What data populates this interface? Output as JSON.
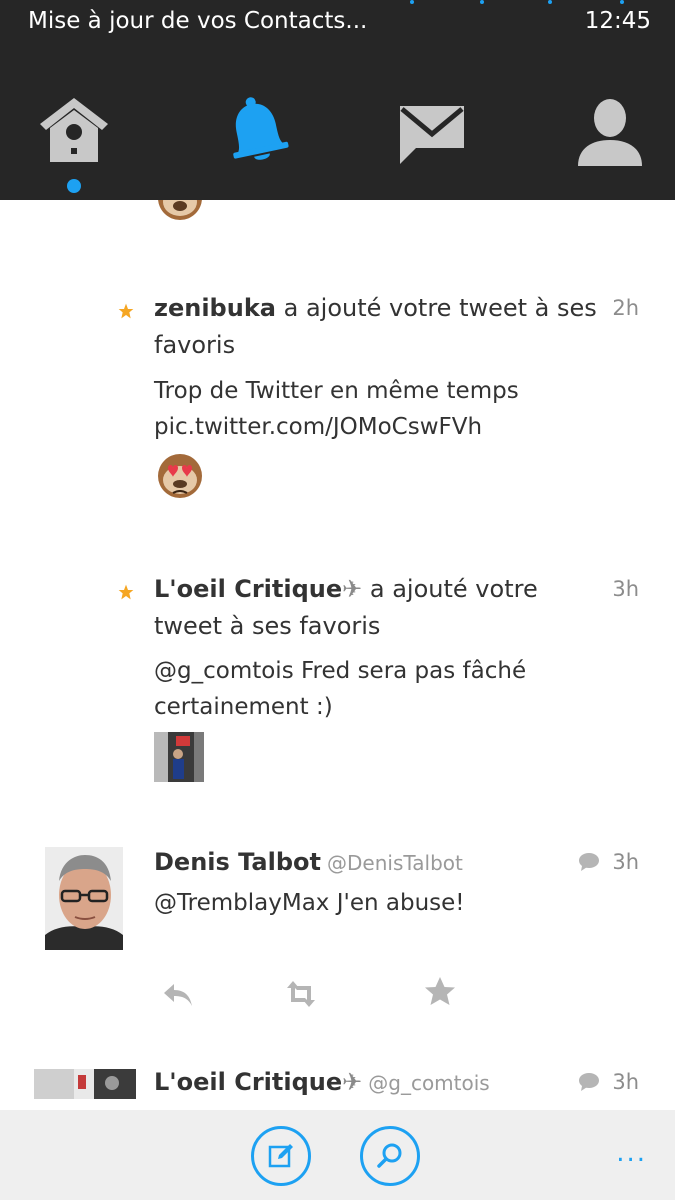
{
  "status_bar": {
    "text": "Mise à jour de vos Contacts...",
    "time": "12:45"
  },
  "nav": {
    "tabs": [
      {
        "icon": "home-birdhouse-icon",
        "active": true
      },
      {
        "icon": "notifications-bell-icon",
        "active": false
      },
      {
        "icon": "messages-envelope-icon",
        "active": false
      },
      {
        "icon": "profile-person-icon",
        "active": false
      }
    ],
    "colors": {
      "accent": "#1da1f2",
      "inactive": "#c8c8c8",
      "bar": "#262626"
    }
  },
  "feed": {
    "notifications": [
      {
        "type": "favorite",
        "actor": "zenibuka",
        "action": "a ajouté votre tweet à ses favoris",
        "time": "2h",
        "tweet_line1": "Trop de Twitter en même temps",
        "tweet_line2": "pic.twitter.com/JOMoCswFVh"
      },
      {
        "type": "favorite",
        "actor": "L'oeil Critique",
        "actor_suffix": "✈",
        "action": "a ajouté votre tweet à ses favoris",
        "time": "3h",
        "tweet_line1": "@g_comtois Fred sera pas fâché",
        "tweet_line2": "certainement :)"
      }
    ],
    "tweets": [
      {
        "name": "Denis Talbot",
        "handle": "@DenisTalbot",
        "time": "3h",
        "text": "@TremblayMax J'en abuse!"
      },
      {
        "name": "L'oeil Critique",
        "name_suffix": "✈",
        "handle": "@g_comtois",
        "time": "3h"
      }
    ],
    "colors": {
      "star": "#f5a623",
      "action_icons": "#b5b5b5"
    }
  },
  "app_bar": {
    "compose_icon": "compose-icon",
    "search_icon": "search-icon",
    "more_label": "..."
  }
}
